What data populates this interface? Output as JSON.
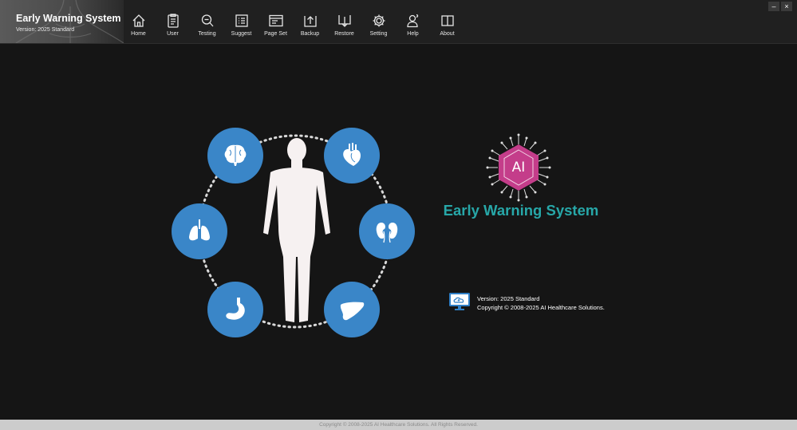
{
  "app": {
    "title": "Early Warning System",
    "version_short": "Version: 2025 Standard"
  },
  "toolbar": {
    "items": [
      {
        "label": "Home",
        "icon": "home-icon"
      },
      {
        "label": "User",
        "icon": "user-clipboard-icon"
      },
      {
        "label": "Testing",
        "icon": "magnifier-icon"
      },
      {
        "label": "Suggest",
        "icon": "checklist-icon"
      },
      {
        "label": "Page Set",
        "icon": "page-layout-icon"
      },
      {
        "label": "Backup",
        "icon": "backup-upload-icon"
      },
      {
        "label": "Restore",
        "icon": "restore-download-icon"
      },
      {
        "label": "Setting",
        "icon": "gear-icon"
      },
      {
        "label": "Help",
        "icon": "help-person-icon"
      },
      {
        "label": "About",
        "icon": "book-icon"
      }
    ]
  },
  "window_controls": {
    "minimize": "–",
    "close": "×"
  },
  "main": {
    "ai_badge": "AI",
    "app_name": "Early Warning System",
    "version": "Version: 2025 Standard",
    "copyright": "Copyright © 2008-2025 AI Healthcare Solutions."
  },
  "footer": {
    "text": "Copyright © 2008-2025 AI Healthcare Solutions. All Rights Reserved."
  },
  "colors": {
    "background": "#151515",
    "organ_circle": "#3a86c8",
    "accent_teal": "#27a7a8",
    "ai_hexagon": "#c43d8a",
    "footer": "#cccccc"
  }
}
